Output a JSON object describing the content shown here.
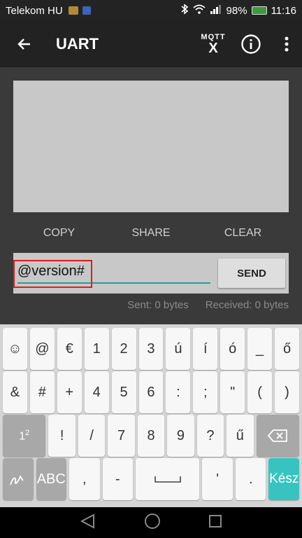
{
  "status_bar": {
    "carrier": "Telekom HU",
    "battery": "98%",
    "time": "11:16"
  },
  "app_bar": {
    "title": "UART",
    "mqtt_top": "MQTT",
    "mqtt_bottom": "X"
  },
  "actions": {
    "copy": "COPY",
    "share": "SHARE",
    "clear": "CLEAR"
  },
  "input": {
    "value": "@version#",
    "send_label": "SEND"
  },
  "counters": {
    "sent": "Sent: 0 bytes",
    "received": "Received: 0 bytes"
  },
  "keyboard": {
    "row1": [
      "☺",
      "@",
      "€",
      "1",
      "2",
      "3",
      "ú",
      "í",
      "ó",
      "_",
      "ő"
    ],
    "row2": [
      "&",
      "#",
      "+",
      "4",
      "5",
      "6",
      ":",
      ";",
      "\"",
      "(",
      ")"
    ],
    "row3": [
      "!",
      "/",
      "7",
      "8",
      "9",
      "?",
      "ű"
    ],
    "row3_pages": "1",
    "row3_pages_sup": "2",
    "row4_abc": "ABC",
    "row4_comma": ",",
    "row4_dash": "-",
    "row4_apos": "'",
    "row4_period": ".",
    "done": "Kész"
  }
}
